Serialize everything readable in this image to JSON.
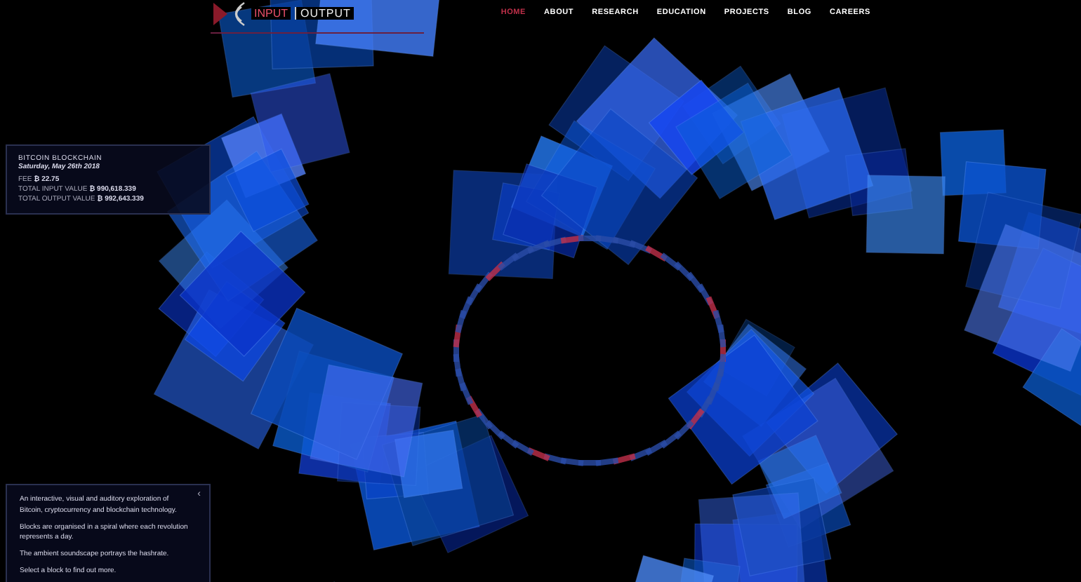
{
  "logo": {
    "input": "INPUT",
    "output": "OUTPUT"
  },
  "nav": [
    {
      "label": "HOME",
      "selected": true
    },
    {
      "label": "ABOUT",
      "selected": false
    },
    {
      "label": "RESEARCH",
      "selected": false
    },
    {
      "label": "EDUCATION",
      "selected": false
    },
    {
      "label": "PROJECTS",
      "selected": false
    },
    {
      "label": "BLOG",
      "selected": false
    },
    {
      "label": "CAREERS",
      "selected": false
    }
  ],
  "block_info": {
    "title": "BITCOIN BLOCKCHAIN",
    "date": "Saturday, May 26th 2018",
    "rows": [
      {
        "label": "FEE",
        "value": "₿ 22.75"
      },
      {
        "label": "TOTAL INPUT VALUE",
        "value": "₿ 990,618.339"
      },
      {
        "label": "TOTAL OUTPUT VALUE",
        "value": "₿ 992,643.339"
      }
    ]
  },
  "about": {
    "close": "‹",
    "paragraphs": [
      "An interactive, visual and auditory exploration of Bitcoin, cryptocurrency and blockchain technology.",
      "Blocks are organised in a spiral where each revolution represents a day.",
      "The ambient soundscape portrays the hashrate.",
      "Select a block to find out more."
    ]
  }
}
